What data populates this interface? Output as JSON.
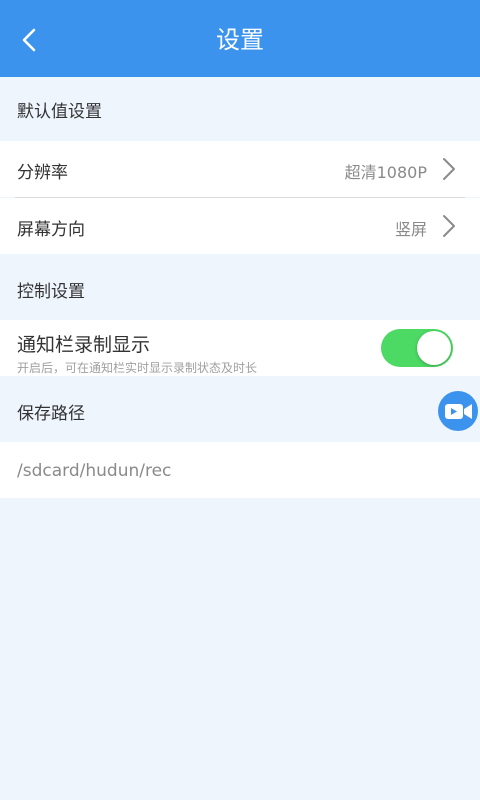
{
  "header": {
    "title": "设置",
    "back_icon": "chevron-left-icon"
  },
  "sections": {
    "default": {
      "title": "默认值设置"
    },
    "control": {
      "title": "控制设置"
    },
    "path": {
      "title": "保存路径"
    }
  },
  "resolution": {
    "label": "分辨率",
    "value": "超清1080P"
  },
  "orientation": {
    "label": "屏幕方向",
    "value": "竖屏"
  },
  "notification": {
    "label": "通知栏录制显示",
    "desc": "开启后，可在通知栏实时显示录制状态及时长",
    "enabled": true
  },
  "save_path": {
    "value": "/sdcard/hudun/rec"
  },
  "colors": {
    "accent": "#3c93ee",
    "background": "#eef5fd",
    "toggle_on": "#4cd964"
  },
  "fab": {
    "icon": "video-camera-icon"
  }
}
